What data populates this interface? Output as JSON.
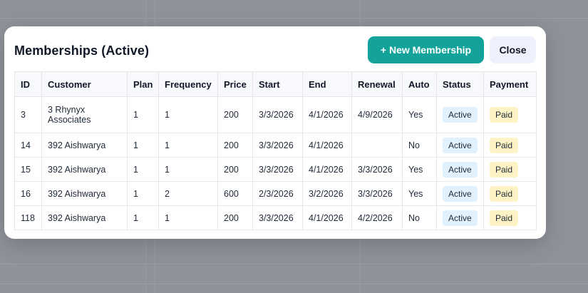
{
  "modal": {
    "title": "Memberships (Active)",
    "new_button_label": "+ New Membership",
    "close_button_label": "Close"
  },
  "table": {
    "columns": [
      "ID",
      "Customer",
      "Plan",
      "Frequency",
      "Price",
      "Start",
      "End",
      "Renewal",
      "Auto",
      "Status",
      "Payment"
    ],
    "rows": [
      {
        "id": "3",
        "customer": "3 Rhynyx Associates",
        "plan": "1",
        "frequency": "1",
        "price": "200",
        "start": "3/3/2026",
        "end": "4/1/2026",
        "renewal": "4/9/2026",
        "auto": "Yes",
        "status": "Active",
        "payment": "Paid"
      },
      {
        "id": "14",
        "customer": "392 Aishwarya",
        "plan": "1",
        "frequency": "1",
        "price": "200",
        "start": "3/3/2026",
        "end": "4/1/2026",
        "renewal": "",
        "auto": "No",
        "status": "Active",
        "payment": "Paid"
      },
      {
        "id": "15",
        "customer": "392 Aishwarya",
        "plan": "1",
        "frequency": "1",
        "price": "200",
        "start": "3/3/2026",
        "end": "4/1/2026",
        "renewal": "3/3/2026",
        "auto": "Yes",
        "status": "Active",
        "payment": "Paid"
      },
      {
        "id": "16",
        "customer": "392 Aishwarya",
        "plan": "1",
        "frequency": "2",
        "price": "600",
        "start": "2/3/2026",
        "end": "3/2/2026",
        "renewal": "3/3/2026",
        "auto": "Yes",
        "status": "Active",
        "payment": "Paid"
      },
      {
        "id": "118",
        "customer": "392 Aishwarya",
        "plan": "1",
        "frequency": "1",
        "price": "200",
        "start": "3/3/2026",
        "end": "4/1/2026",
        "renewal": "4/2/2026",
        "auto": "No",
        "status": "Active",
        "payment": "Paid"
      }
    ]
  },
  "colors": {
    "accent": "#14a39a",
    "status_badge_bg": "#e1f1fd",
    "payment_badge_bg": "#fdf3c4",
    "overlay": "#8f9299"
  }
}
